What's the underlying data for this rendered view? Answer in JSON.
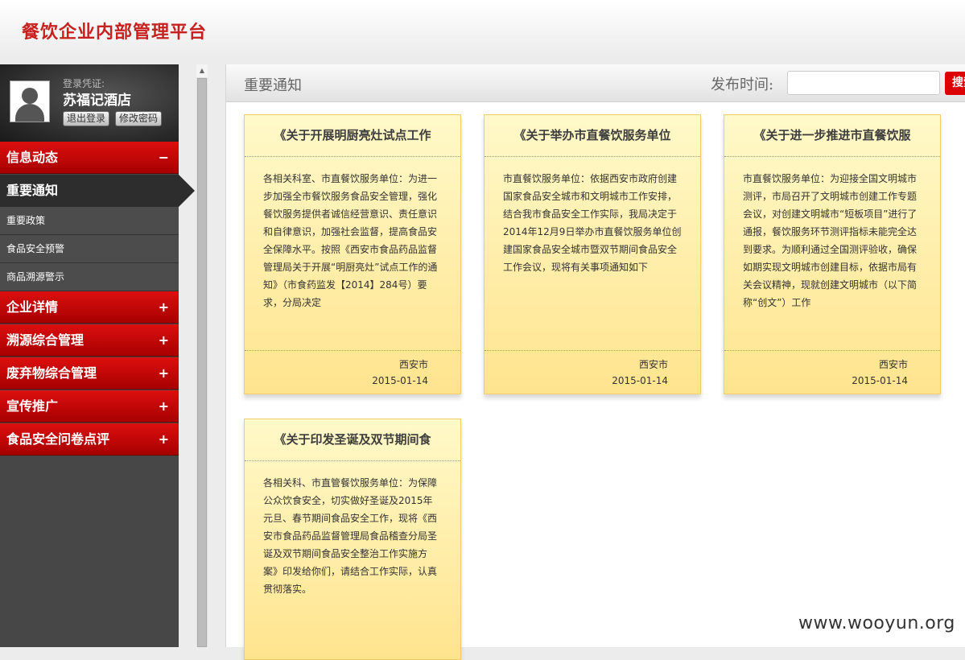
{
  "app": {
    "title": "餐饮企业内部管理平台"
  },
  "user": {
    "login_label": "登录凭证:",
    "name": "苏福记酒店",
    "logout_label": "退出登录",
    "change_password_label": "修改密码"
  },
  "sidebar": {
    "groups": [
      {
        "label": "信息动态",
        "toggle": "−"
      },
      {
        "label": "企业详情",
        "toggle": "+"
      },
      {
        "label": "溯源综合管理",
        "toggle": "+"
      },
      {
        "label": "废弃物综合管理",
        "toggle": "+"
      },
      {
        "label": "宣传推广",
        "toggle": "+"
      },
      {
        "label": "食品安全问卷点评",
        "toggle": "+"
      }
    ],
    "active_item": "重要通知",
    "sub_items": [
      "重要政策",
      "食品安全预警",
      "商品溯源警示"
    ]
  },
  "toolbar": {
    "section_title": "重要通知",
    "date_label": "发布时间:",
    "date_value": "",
    "search_label": "搜索"
  },
  "cards": [
    {
      "title": "《关于开展明厨亮灶试点工作",
      "body": "各相关科室、市直餐饮服务单位：为进一步加强全市餐饮服务食品安全管理，强化餐饮服务提供者诚信经营意识、责任意识和自律意识，加强社会监督，提高食品安全保障水平。按照《西安市食品药品监督管理局关于开展“明厨亮灶”试点工作的通知》（市食药监发【2014】284号）要求，分局决定",
      "source": "西安市",
      "date": "2015-01-14"
    },
    {
      "title": "《关于举办市直餐饮服务单位",
      "body": "市直餐饮服务单位：依据西安市政府创建国家食品安全城市和文明城市工作安排，结合我市食品安全工作实际，我局决定于2014年12月9日举办市直餐饮服务单位创建国家食品安全城市暨双节期间食品安全工作会议，现将有关事项通知如下",
      "source": "西安市",
      "date": "2015-01-14"
    },
    {
      "title": "《关于进一步推进市直餐饮服",
      "body": "市直餐饮服务单位：为迎接全国文明城市测评，市局召开了文明城市创建工作专题会议，对创建文明城市“短板项目”进行了通报，餐饮服务环节测评指标未能完全达到要求。为顺利通过全国测评验收，确保如期实现文明城市创建目标，依据市局有关会议精神，现就创建文明城市（以下简称“创文”）工作",
      "source": "西安市",
      "date": "2015-01-14"
    },
    {
      "title": "《关于印发圣诞及双节期间食",
      "body": "各相关科、市直管餐饮服务单位：为保障公众饮食安全，切实做好圣诞及2015年元旦、春节期间食品安全工作，现将《西安市食品药品监督管理局食品稽查分局圣诞及双节期间食品安全整治工作实施方案》印发给你们，请结合工作实际，认真贯彻落实。"
    }
  ],
  "watermark": "www.wooyun.org"
}
